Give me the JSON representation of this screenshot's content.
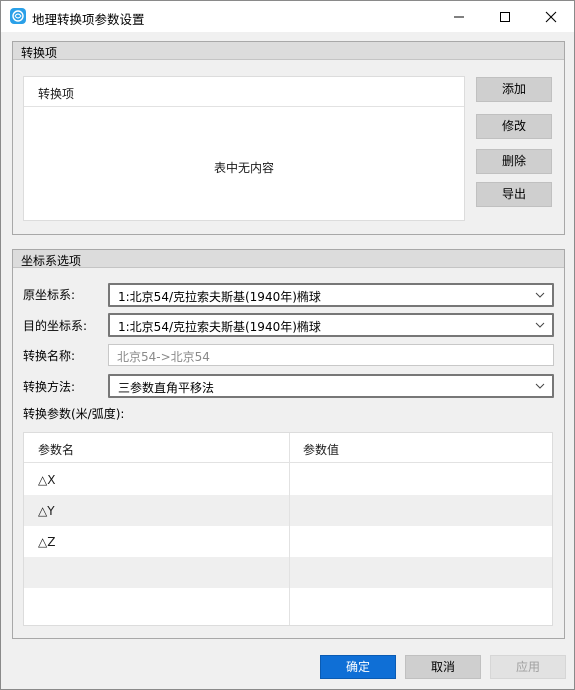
{
  "window": {
    "title": "地理转换项参数设置",
    "accent": "#0f6fd6"
  },
  "conversion_group": {
    "title": "转换项",
    "list_header": "转换项",
    "empty_text": "表中无内容",
    "buttons": {
      "add": "添加",
      "modify": "修改",
      "delete": "删除",
      "export": "导出"
    }
  },
  "coord_group": {
    "title": "坐标系选项",
    "source_label": "原坐标系:",
    "source_value": "1:北京54/克拉索夫斯基(1940年)椭球",
    "target_label": "目的坐标系:",
    "target_value": "1:北京54/克拉索夫斯基(1940年)椭球",
    "name_label": "转换名称:",
    "name_placeholder": "北京54->北京54",
    "method_label": "转换方法:",
    "method_value": "三参数直角平移法",
    "params_label": "转换参数(米/弧度):"
  },
  "param_table": {
    "columns": [
      "参数名",
      "参数值"
    ],
    "rows": [
      {
        "name": "△X",
        "value": ""
      },
      {
        "name": "△Y",
        "value": ""
      },
      {
        "name": "△Z",
        "value": ""
      },
      {
        "name": "",
        "value": ""
      },
      {
        "name": "",
        "value": ""
      }
    ]
  },
  "footer": {
    "ok": "确定",
    "cancel": "取消",
    "apply": "应用"
  }
}
